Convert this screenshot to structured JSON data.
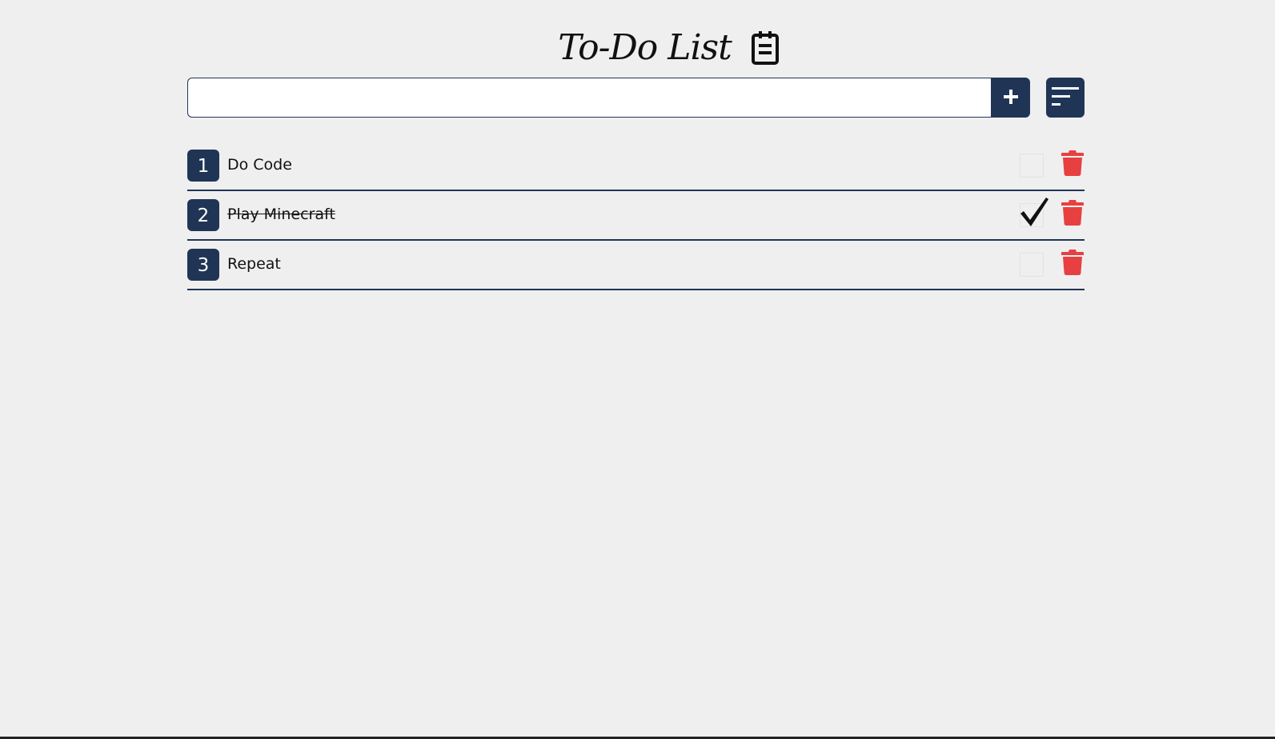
{
  "header": {
    "title": "To-Do List",
    "icon": "clipboard-icon"
  },
  "add_form": {
    "input_value": "",
    "add_icon": "plus-icon",
    "sort_icon": "sort-lines-icon"
  },
  "colors": {
    "background": "#efefef",
    "accent": "#203556",
    "delete": "#e84040"
  },
  "items": [
    {
      "number": "1",
      "text": "Do Code",
      "completed": false
    },
    {
      "number": "2",
      "text": "Play Minecraft",
      "completed": true
    },
    {
      "number": "3",
      "text": "Repeat",
      "completed": false
    }
  ]
}
